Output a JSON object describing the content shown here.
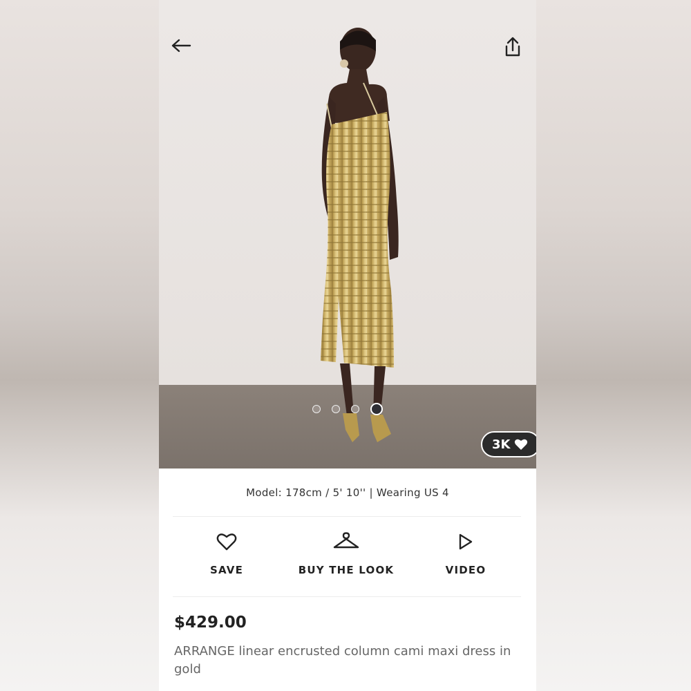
{
  "hero": {
    "carousel_dots": 4,
    "active_dot": 4,
    "likes_count": "3K"
  },
  "model_info": "Model: 178cm / 5' 10'' | Wearing US 4",
  "actions": {
    "save_label": "SAVE",
    "buy_the_look_label": "BUY THE LOOK",
    "video_label": "VIDEO"
  },
  "product": {
    "price": "$429.00",
    "title": "ARRANGE linear encrusted column cami maxi dress in gold"
  },
  "icons": [
    "back-arrow-icon",
    "share-icon",
    "heart-icon",
    "hanger-icon",
    "play-icon"
  ],
  "colors": {
    "likes_badge_bg": "#2b2b2b",
    "active_dot": "#2e2e34",
    "text_primary": "#222222",
    "text_secondary": "#666666"
  }
}
